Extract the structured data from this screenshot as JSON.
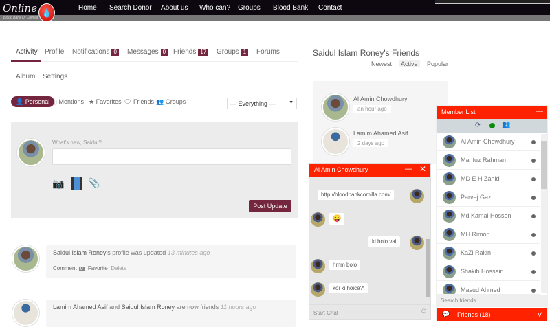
{
  "logo": {
    "title": "Online",
    "subtitle": "Blood Bank Of Comilla"
  },
  "nav": [
    "Home",
    "Search Donor",
    "About us",
    "Who can?",
    "Groups",
    "Blood Bank",
    "Contact"
  ],
  "tabs": [
    {
      "label": "Activity"
    },
    {
      "label": "Profile"
    },
    {
      "label": "Notifications",
      "count": "0"
    },
    {
      "label": "Messages",
      "count": "0"
    },
    {
      "label": "Friends",
      "count": "17"
    },
    {
      "label": "Groups",
      "count": "1"
    },
    {
      "label": "Forums"
    }
  ],
  "subtabs": [
    "Album",
    "Settings"
  ],
  "filters": [
    "Personal",
    "Mentions",
    "Favorites",
    "Friends",
    "Groups"
  ],
  "filter_select": "— Everything —",
  "post": {
    "prompt": "What's new, Saidul?",
    "button": "Post Update"
  },
  "activity": [
    {
      "name": "Saidul Islam Roney",
      "text": "'s profile was updated",
      "time": "13 minutes ago",
      "comment": "Comment",
      "comment_count": "0",
      "favorite": "Favorite",
      "delete": "Delete"
    },
    {
      "name1": "Lamim Ahamed Asif",
      "and": "and",
      "name2": "Saidul Islam Roney",
      "text": "are now friends",
      "time": "11 hours ago"
    }
  ],
  "friends": {
    "title": "Saidul Islam Roney's Friends",
    "tabs": [
      "Newest",
      "Active",
      "Popular"
    ],
    "items": [
      {
        "name": "Al Amin Chowdhury",
        "ago": "an hour ago"
      },
      {
        "name": "Lamim Ahamed Asif",
        "ago": "2 days ago"
      }
    ]
  },
  "chat": {
    "title": "Al Amin Chowdhury",
    "messages": [
      "http://bloodbankcomilla.com/",
      "😛",
      "ki holo vai",
      "hmm bolo",
      "koi ki hoice?\\"
    ],
    "placeholder": "Start Chat"
  },
  "members": {
    "title": "Member List",
    "items": [
      "Al Amin Chowdhury",
      "Mahfuz Rahman",
      "MD E H Zahid",
      "Parvej Gazi",
      "Md Kamal Hossen",
      "MH Rimon",
      "KaZi Rakin",
      "Shakib Hossain",
      "Masud Ahmed"
    ],
    "search": "Search friends",
    "footer": "Friends (18)",
    "footer_toggle": "V"
  }
}
